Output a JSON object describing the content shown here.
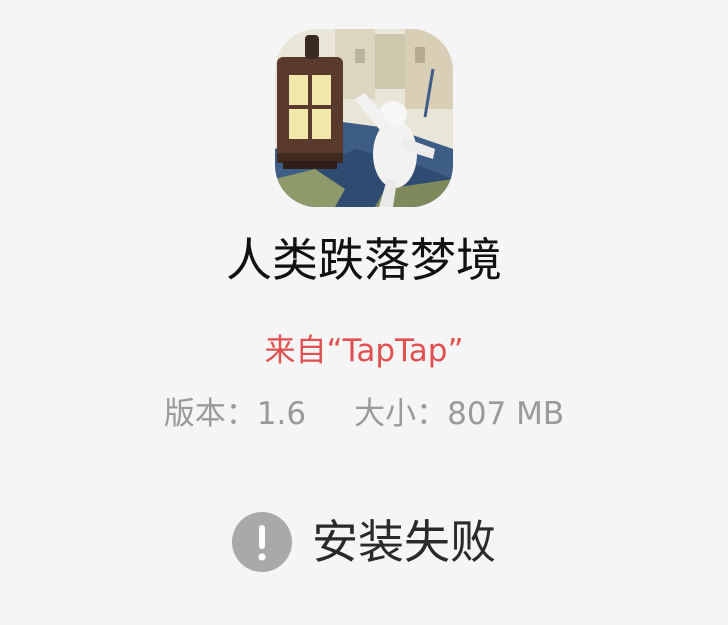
{
  "app": {
    "name": "人类跌落梦境",
    "source": "来自“TapTap”",
    "version_text": "版本：1.6",
    "size_text": "大小：807 MB"
  },
  "status": {
    "text": "安装失败",
    "icon": "warning-icon",
    "icon_color": "#a9a9a9"
  },
  "colors": {
    "background": "#f5f5f5",
    "source_text": "#e05050",
    "meta_text": "#9a9a9a",
    "title_text": "#111111"
  }
}
